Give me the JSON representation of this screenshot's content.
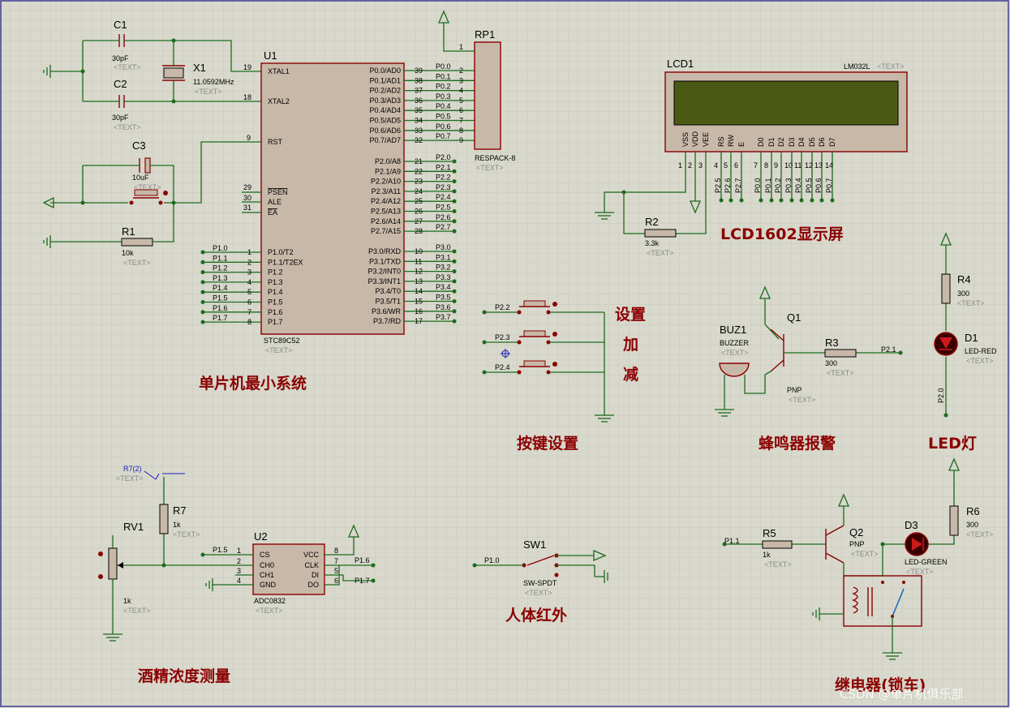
{
  "titles": {
    "mcu": "单片机最小系统",
    "lcd": "LCD1602显示屏",
    "keys": "按键设置",
    "buzzer": "蜂鸣器报警",
    "led": "LED灯",
    "alcohol": "酒精浓度测量",
    "pir": "人体红外",
    "relay": "继电器(锁车)",
    "key_set": "设置",
    "key_add": "加",
    "key_sub": "减"
  },
  "text_placeholder": "<TEXT>",
  "watermark": "CSDN @单片机俱乐部",
  "u1": {
    "ref": "U1",
    "part": "STC89C52",
    "left_pins": [
      {
        "num": "19",
        "name": "XTAL1"
      },
      {
        "num": "18",
        "name": "XTAL2"
      },
      {
        "num": "9",
        "name": "RST"
      },
      {
        "num": "29",
        "name": "PSEN"
      },
      {
        "num": "30",
        "name": "ALE"
      },
      {
        "num": "31",
        "name": "EA"
      },
      {
        "num": "1",
        "name": "P1.0/T2"
      },
      {
        "num": "2",
        "name": "P1.1/T2EX"
      },
      {
        "num": "3",
        "name": "P1.2"
      },
      {
        "num": "4",
        "name": "P1.3"
      },
      {
        "num": "5",
        "name": "P1.4"
      },
      {
        "num": "6",
        "name": "P1.5"
      },
      {
        "num": "7",
        "name": "P1.6"
      },
      {
        "num": "8",
        "name": "P1.7"
      }
    ],
    "p1_nets": [
      "P1.0",
      "P1.1",
      "P1.2",
      "P1.3",
      "P1.4",
      "P1.5",
      "P1.6",
      "P1.7"
    ],
    "p0_pins": [
      {
        "num": "39",
        "name": "P0.0/AD0",
        "net": "P0.0",
        "rp": "2"
      },
      {
        "num": "38",
        "name": "P0.1/AD1",
        "net": "P0.1",
        "rp": "3"
      },
      {
        "num": "37",
        "name": "P0.2/AD2",
        "net": "P0.2",
        "rp": "4"
      },
      {
        "num": "36",
        "name": "P0.3/AD3",
        "net": "P0.3",
        "rp": "5"
      },
      {
        "num": "35",
        "name": "P0.4/AD4",
        "net": "P0.4",
        "rp": "6"
      },
      {
        "num": "34",
        "name": "P0.5/AD5",
        "net": "P0.5",
        "rp": "7"
      },
      {
        "num": "33",
        "name": "P0.6/AD6",
        "net": "P0.6",
        "rp": "8"
      },
      {
        "num": "32",
        "name": "P0.7/AD7",
        "net": "P0.7",
        "rp": "9"
      }
    ],
    "p2_pins": [
      {
        "num": "21",
        "name": "P2.0/A8",
        "net": "P2.0"
      },
      {
        "num": "22",
        "name": "P2.1/A9",
        "net": "P2.1"
      },
      {
        "num": "23",
        "name": "P2.2/A10",
        "net": "P2.2"
      },
      {
        "num": "24",
        "name": "P2.3/A11",
        "net": "P2.3"
      },
      {
        "num": "25",
        "name": "P2.4/A12",
        "net": "P2.4"
      },
      {
        "num": "26",
        "name": "P2.5/A13",
        "net": "P2.5"
      },
      {
        "num": "27",
        "name": "P2.6/A14",
        "net": "P2.6"
      },
      {
        "num": "28",
        "name": "P2.7/A15",
        "net": "P2.7"
      }
    ],
    "p3_pins": [
      {
        "num": "10",
        "name": "P3.0/RXD",
        "net": "P3.0"
      },
      {
        "num": "11",
        "name": "P3.1/TXD",
        "net": "P3.1"
      },
      {
        "num": "12",
        "name": "P3.2/INT0",
        "net": "P3.2"
      },
      {
        "num": "13",
        "name": "P3.3/INT1",
        "net": "P3.3"
      },
      {
        "num": "14",
        "name": "P3.4/T0",
        "net": "P3.4"
      },
      {
        "num": "15",
        "name": "P3.5/T1",
        "net": "P3.5"
      },
      {
        "num": "16",
        "name": "P3.6/WR",
        "net": "P3.6"
      },
      {
        "num": "17",
        "name": "P3.7/RD",
        "net": "P3.7"
      }
    ]
  },
  "c1": {
    "ref": "C1",
    "value": "30pF"
  },
  "c2": {
    "ref": "C2",
    "value": "30pF"
  },
  "c3": {
    "ref": "C3",
    "value": "10uF"
  },
  "x1": {
    "ref": "X1",
    "value": "11.0592MHz"
  },
  "r1": {
    "ref": "R1",
    "value": "10k"
  },
  "rp1": {
    "ref": "RP1",
    "part": "RESPACK-8",
    "pin1": "1"
  },
  "lcd": {
    "ref": "LCD1",
    "part": "LM032L",
    "pins": [
      "VSS",
      "VDD",
      "VEE",
      "RS",
      "RW",
      "E",
      "D0",
      "D1",
      "D2",
      "D3",
      "D4",
      "D5",
      "D6",
      "D7"
    ],
    "pin_nums": [
      "1",
      "2",
      "3",
      "4",
      "5",
      "6",
      "7",
      "8",
      "9",
      "10",
      "11",
      "12",
      "13",
      "14"
    ],
    "ctrl_nets": [
      "P2.5",
      "P2.6",
      "P2.7"
    ],
    "data_nets": [
      "P0.0",
      "P0.1",
      "P0.2",
      "P0.3",
      "P0.4",
      "P0.5",
      "P0.6",
      "P0.7"
    ]
  },
  "r2": {
    "ref": "R2",
    "value": "3.3k"
  },
  "keys": {
    "nets": [
      "P2.2",
      "P2.3",
      "P2.4"
    ]
  },
  "buz1": {
    "ref": "BUZ1",
    "part": "BUZZER"
  },
  "q1": {
    "ref": "Q1",
    "type": "PNP"
  },
  "r3": {
    "ref": "R3",
    "value": "300",
    "net": "P2.1"
  },
  "r4": {
    "ref": "R4",
    "value": "300"
  },
  "d1": {
    "ref": "D1",
    "part": "LED-RED",
    "net": "P2.0"
  },
  "r7": {
    "ref": "R7",
    "value": "1k",
    "probe": "R7(2)"
  },
  "rv1": {
    "ref": "RV1",
    "value": "1k"
  },
  "u2": {
    "ref": "U2",
    "part": "ADC0832",
    "left_pins": [
      {
        "num": "1",
        "name": "CS"
      },
      {
        "num": "2",
        "name": "CH0"
      },
      {
        "num": "3",
        "name": "CH1"
      },
      {
        "num": "4",
        "name": "GND"
      }
    ],
    "right_pins": [
      {
        "num": "8",
        "name": "VCC"
      },
      {
        "num": "7",
        "name": "CLK"
      },
      {
        "num": "5",
        "name": "DI"
      },
      {
        "num": "6",
        "name": "DO"
      }
    ],
    "nets": {
      "cs": "P1.5",
      "clk": "P1.6",
      "do": "P1.7"
    }
  },
  "sw1": {
    "ref": "SW1",
    "part": "SW-SPDT",
    "net": "P1.0"
  },
  "r5": {
    "ref": "R5",
    "value": "1k",
    "net": "P1.1"
  },
  "q2": {
    "ref": "Q2",
    "type": "PNP"
  },
  "d3": {
    "ref": "D3",
    "part": "LED-GREEN"
  },
  "r6": {
    "ref": "R6",
    "value": "300"
  },
  "colors": {
    "background": "#d8d8cc",
    "grid": "#c4c4b8",
    "wire": "#1c6b1c",
    "component": "#8b0000",
    "body": "#c8b8a8",
    "title": "#8b0000"
  }
}
